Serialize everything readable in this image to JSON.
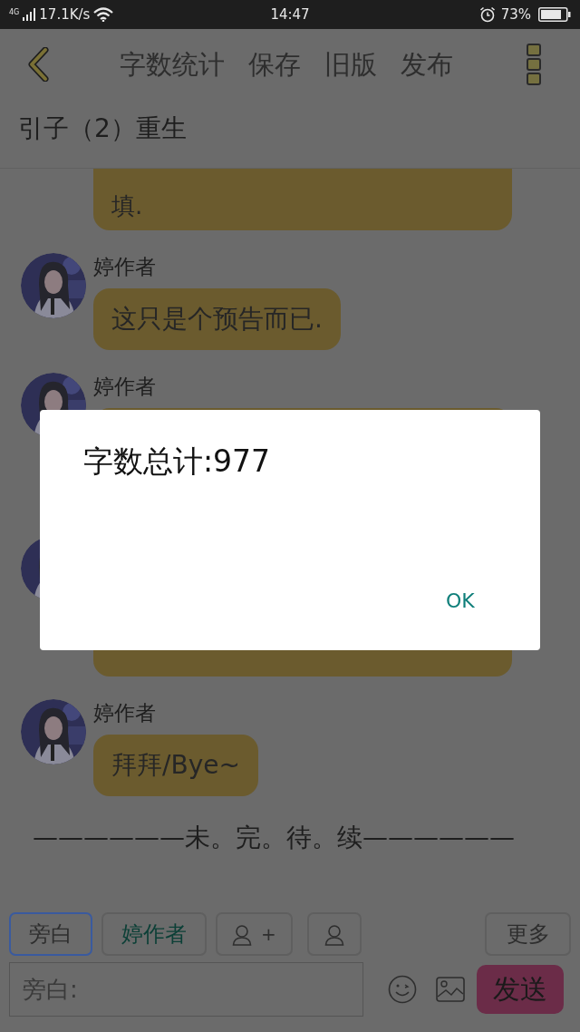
{
  "status_bar": {
    "network": "4G",
    "speed": "17.1K/s",
    "time": "14:47",
    "battery": "73%"
  },
  "toolbar": {
    "actions": [
      "字数统计",
      "保存",
      "旧版",
      "发布"
    ]
  },
  "chapter_title": "引子（2）重生",
  "messages": [
    {
      "kind": "continuation",
      "text": "填."
    },
    {
      "kind": "message",
      "name": "婷作者",
      "text": "这只是个预告而已."
    },
    {
      "kind": "message",
      "name": "婷作者"
    },
    {
      "kind": "message"
    },
    {
      "kind": "message",
      "name": "婷作者",
      "text": "拜拜/Bye~"
    }
  ],
  "end_note": "——————未。完。待。续——————",
  "roles": [
    {
      "kind": "narrator",
      "label": "旁白",
      "selected": true
    },
    {
      "kind": "character",
      "label": "婷作者",
      "selected": false
    },
    {
      "kind": "add-character",
      "label": "+",
      "selected": false
    },
    {
      "kind": "character-picker",
      "selected": false
    }
  ],
  "more_button": "更多",
  "input": {
    "placeholder": "旁白:"
  },
  "send_button": "发送",
  "dialog": {
    "message": "字数总计:977",
    "button": "OK"
  }
}
